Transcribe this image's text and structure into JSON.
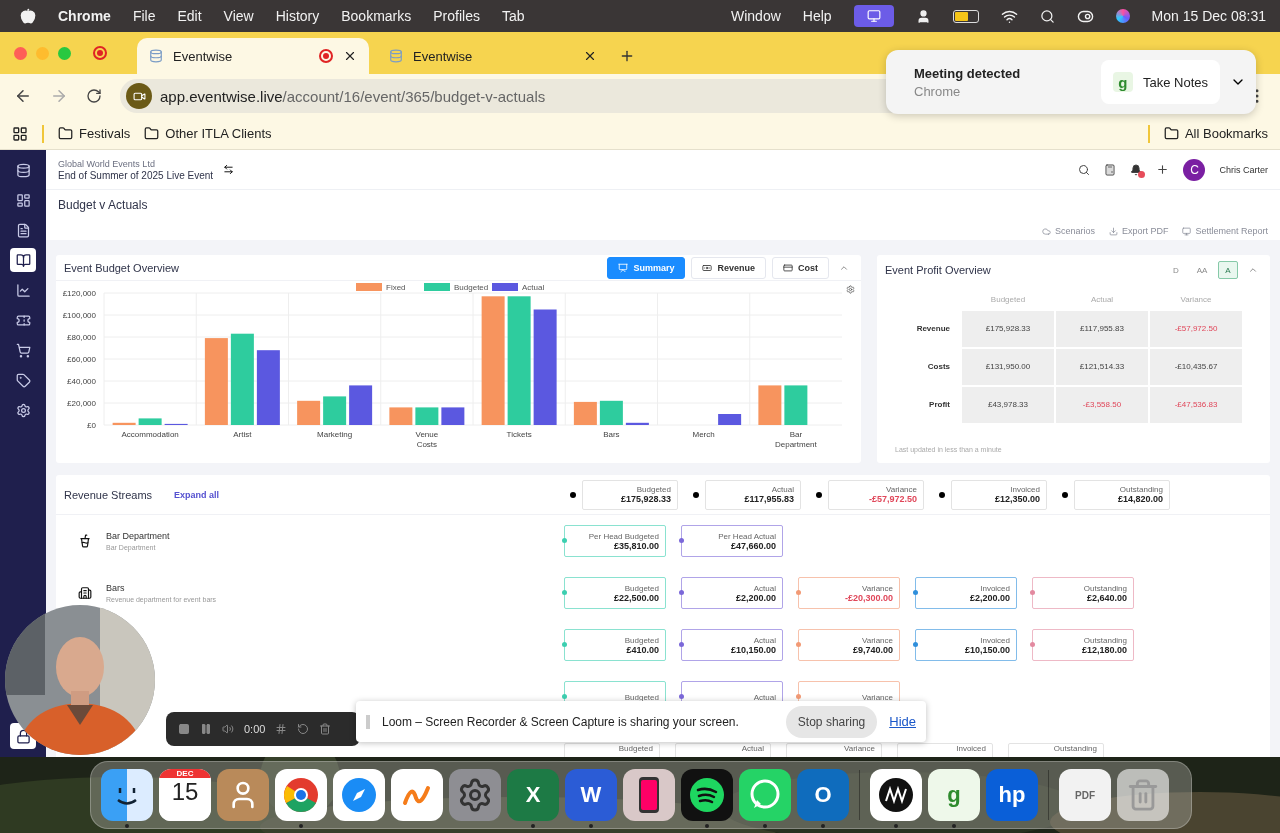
{
  "menu_bar": {
    "app": "Chrome",
    "items": [
      "File",
      "Edit",
      "View",
      "History",
      "Bookmarks",
      "Profiles",
      "Tab"
    ],
    "right_items": [
      "Window",
      "Help"
    ],
    "clock": "Mon 15 Dec 08:31"
  },
  "browser": {
    "tabs": [
      {
        "label": "Eventwise",
        "selected": true
      },
      {
        "label": "Eventwise",
        "selected": false
      }
    ],
    "address": {
      "host": "app.eventwise.live",
      "path": "/account/16/event/365/budget-v-actuals"
    },
    "bookmarks": [
      "Festivals",
      "Other ITLA Clients"
    ],
    "all_bookmarks": "All Bookmarks"
  },
  "meeting_popup": {
    "title": "Meeting detected",
    "subtitle": "Chrome",
    "logo": "g",
    "action": "Take Notes"
  },
  "sidebar": {
    "items": [
      {
        "selected": false
      },
      {
        "selected": false
      },
      {
        "selected": false
      },
      {
        "selected": true
      },
      {
        "selected": false
      },
      {
        "selected": false
      },
      {
        "selected": false
      },
      {
        "selected": false
      },
      {
        "selected": false
      }
    ]
  },
  "header": {
    "org": "Global World Events Ltd",
    "event": "End of Summer of 2025 Live Event",
    "user": {
      "initial": "C",
      "name": "Chris Carter"
    }
  },
  "page_title": "Budget v Actuals",
  "actions": [
    "Scenarios",
    "Export PDF",
    "Settlement Report"
  ],
  "budget_overview": {
    "title": "Event Budget Overview",
    "views": [
      {
        "label": "Summary",
        "selected": true
      },
      {
        "label": "Revenue",
        "selected": false
      },
      {
        "label": "Cost",
        "selected": false
      }
    ],
    "chart_data": {
      "type": "bar",
      "categories": [
        "Accommodation",
        "Artist",
        "Marketing",
        "Venue Costs",
        "Tickets",
        "Bars",
        "Merch",
        "Bar Department"
      ],
      "series": [
        {
          "name": "Fixed",
          "color": "#f7945e",
          "values": [
            2000,
            79000,
            22000,
            16000,
            117000,
            21000,
            null,
            36000
          ]
        },
        {
          "name": "Budgeted",
          "color": "#2ecc9e",
          "values": [
            6000,
            83000,
            26000,
            16000,
            117000,
            22000,
            null,
            36000
          ]
        },
        {
          "name": "Actual",
          "color": "#5b58e0",
          "values": [
            1000,
            68000,
            36000,
            16000,
            105000,
            2000,
            10000,
            null
          ]
        }
      ],
      "ylim": [
        0,
        120000
      ],
      "grid": true,
      "legend": true,
      "yticks": [
        {
          "value": 0,
          "label": "£0"
        },
        {
          "value": 20000,
          "label": "£20,000"
        },
        {
          "value": 40000,
          "label": "£40,000"
        },
        {
          "value": 60000,
          "label": "£60,000"
        },
        {
          "value": 80000,
          "label": "£80,000"
        },
        {
          "value": 100000,
          "label": "£100,000"
        },
        {
          "value": 120000,
          "label": "£120,000"
        }
      ]
    }
  },
  "profit_overview": {
    "title": "Event Profit Overview",
    "levels": [
      {
        "label": "D",
        "selected": false
      },
      {
        "label": "AA",
        "selected": false
      },
      {
        "label": "A",
        "selected": true
      }
    ],
    "columns": [
      "Budgeted",
      "Actual",
      "Variance"
    ],
    "rows": [
      {
        "label": "Revenue",
        "values": [
          {
            "text": "£175,928.33",
            "negative": false
          },
          {
            "text": "£117,955.83",
            "negative": false
          },
          {
            "text": "-£57,972.50",
            "negative": true
          }
        ]
      },
      {
        "label": "Costs",
        "values": [
          {
            "text": "£131,950.00",
            "negative": false
          },
          {
            "text": "£121,514.33",
            "negative": false
          },
          {
            "text": "-£10,435.67",
            "negative": false
          }
        ]
      },
      {
        "label": "Profit",
        "values": [
          {
            "text": "£43,978.33",
            "negative": false
          },
          {
            "text": "-£3,558.50",
            "negative": true
          },
          {
            "text": "-£47,536.83",
            "negative": true
          }
        ]
      }
    ],
    "footnote": "Last updated in less than a minute"
  },
  "revenue_streams": {
    "title": "Revenue Streams",
    "expand": "Expand all",
    "totals": [
      {
        "label": "Budgeted",
        "value": "£175,928.33",
        "negative": false
      },
      {
        "label": "Actual",
        "value": "£117,955.83",
        "negative": false
      },
      {
        "label": "Variance",
        "value": "-£57,972.50",
        "negative": true
      },
      {
        "label": "Invoiced",
        "value": "£12,350.00",
        "negative": false
      },
      {
        "label": "Outstanding",
        "value": "£14,820.00",
        "negative": false
      }
    ],
    "rows": [
      {
        "name": "Bar Department",
        "description": "Bar Department",
        "metrics": [
          {
            "label": "Per Head Budgeted",
            "value": "£35,810.00",
            "color": "#3ccfb0",
            "negative": false
          },
          {
            "label": "Per Head Actual",
            "value": "£47,660.00",
            "color": "#7b68d9",
            "negative": false
          }
        ]
      },
      {
        "name": "Bars",
        "description": "Revenue department for event bars",
        "metrics": [
          {
            "label": "Budgeted",
            "value": "£22,500.00",
            "color": "#3ccfb0",
            "negative": false
          },
          {
            "label": "Actual",
            "value": "£2,200.00",
            "color": "#7b68d9",
            "negative": false
          },
          {
            "label": "Variance",
            "value": "-£20,300.00",
            "color": "#f29a75",
            "negative": true
          },
          {
            "label": "Invoiced",
            "value": "£2,200.00",
            "color": "#2f8fdc",
            "negative": false
          },
          {
            "label": "Outstanding",
            "value": "£2,640.00",
            "color": "#e38aa0",
            "negative": false
          }
        ]
      },
      {
        "metrics": [
          {
            "label": "Budgeted",
            "value": "£410.00",
            "color": "#3ccfb0",
            "negative": false
          },
          {
            "label": "Actual",
            "value": "£10,150.00",
            "color": "#7b68d9",
            "negative": false
          },
          {
            "label": "Variance",
            "value": "£9,740.00",
            "color": "#f29a75",
            "negative": false
          },
          {
            "label": "Invoiced",
            "value": "£10,150.00",
            "color": "#2f8fdc",
            "negative": false
          },
          {
            "label": "Outstanding",
            "value": "£12,180.00",
            "color": "#e38aa0",
            "negative": false
          }
        ]
      },
      {
        "metrics": [
          {
            "label": "Budgeted",
            "color": "#3ccfb0"
          },
          {
            "label": "Actual",
            "color": "#7b68d9"
          },
          {
            "label": "Variance",
            "color": "#f29a75"
          }
        ]
      }
    ],
    "next_totals": [
      "Budgeted",
      "Actual",
      "Variance",
      "Invoiced",
      "Outstanding"
    ]
  },
  "recorder": {
    "timer": "0:00"
  },
  "loom_banner": {
    "message": "Loom – Screen Recorder & Screen Capture is sharing your screen.",
    "stop": "Stop sharing",
    "hide": "Hide"
  },
  "dock": {
    "apps": [
      {
        "kind": "finder",
        "running": true
      },
      {
        "kind": "calendar",
        "month": "DEC",
        "day": "15",
        "running": false
      },
      {
        "kind": "contacts",
        "running": false
      },
      {
        "kind": "chrome",
        "running": true
      },
      {
        "kind": "safari",
        "running": false
      },
      {
        "kind": "freeform",
        "running": false
      },
      {
        "kind": "settings",
        "running": false
      },
      {
        "kind": "excel",
        "glyph": "X",
        "running": true
      },
      {
        "kind": "word",
        "glyph": "W",
        "running": true
      },
      {
        "kind": "phone",
        "running": false
      },
      {
        "kind": "spotify",
        "running": true
      },
      {
        "kind": "whatsapp",
        "running": true
      },
      {
        "kind": "outlook",
        "glyph": "O",
        "running": true
      },
      {
        "kind": "separator"
      },
      {
        "kind": "wave",
        "running": true
      },
      {
        "kind": "notes",
        "glyph": "g",
        "running": true
      },
      {
        "kind": "hp",
        "glyph": "hp",
        "running": false
      },
      {
        "kind": "separator"
      },
      {
        "kind": "document",
        "glyph": "PDF",
        "running": false
      },
      {
        "kind": "trash",
        "running": false
      }
    ]
  }
}
